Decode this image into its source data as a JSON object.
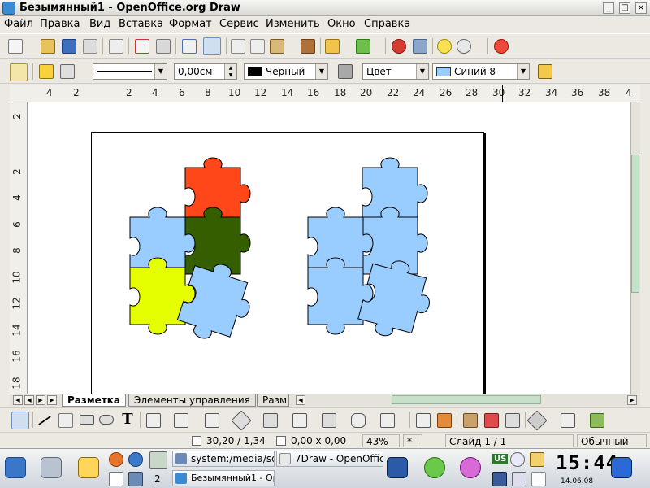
{
  "window": {
    "title": "Безымянный1 - OpenOffice.org Draw",
    "controls": [
      "_",
      "□",
      "×"
    ]
  },
  "menu": [
    "Файл",
    "Правка",
    "Вид",
    "Вставка",
    "Формат",
    "Сервис",
    "Изменить",
    "Окно",
    "Справка"
  ],
  "line_toolbar": {
    "line_width": "0,00см",
    "line_color": "Черный",
    "area_style": "Цвет",
    "area_color": "Синий 8"
  },
  "ruler": {
    "horizontal": [
      "4",
      "2",
      "2",
      "4",
      "6",
      "8",
      "10",
      "12",
      "14",
      "16",
      "18",
      "20",
      "22",
      "24",
      "26",
      "28",
      "30",
      "32",
      "34",
      "36",
      "38",
      "4"
    ],
    "vertical_top": "2",
    "vertical": [
      "2",
      "4",
      "6",
      "8",
      "10",
      "12",
      "14",
      "16",
      "18"
    ]
  },
  "tabs": [
    "Разметка",
    "Элементы управления",
    "Разм"
  ],
  "status": {
    "position": "30,20 / 1,34",
    "size": "0,00 x 0,00",
    "zoom": "43%",
    "modified": "*",
    "slide": "Слайд 1 / 1",
    "layout": "Обычный"
  },
  "taskbar": {
    "desktop_number": "2",
    "task1": "system:/media/sd",
    "task2": "7Draw - OpenOffic",
    "task3": "Безымянный1 - Ope",
    "keyboard_layout": "US",
    "clock": "15:44",
    "date": "14.06.08"
  },
  "colors": {
    "red_piece": "#ff4719",
    "dark_green_piece": "#355e00",
    "yellow_piece": "#e6ff00",
    "blue_piece": "#99ccff",
    "scroll_thumb": "#c6e0c9"
  }
}
